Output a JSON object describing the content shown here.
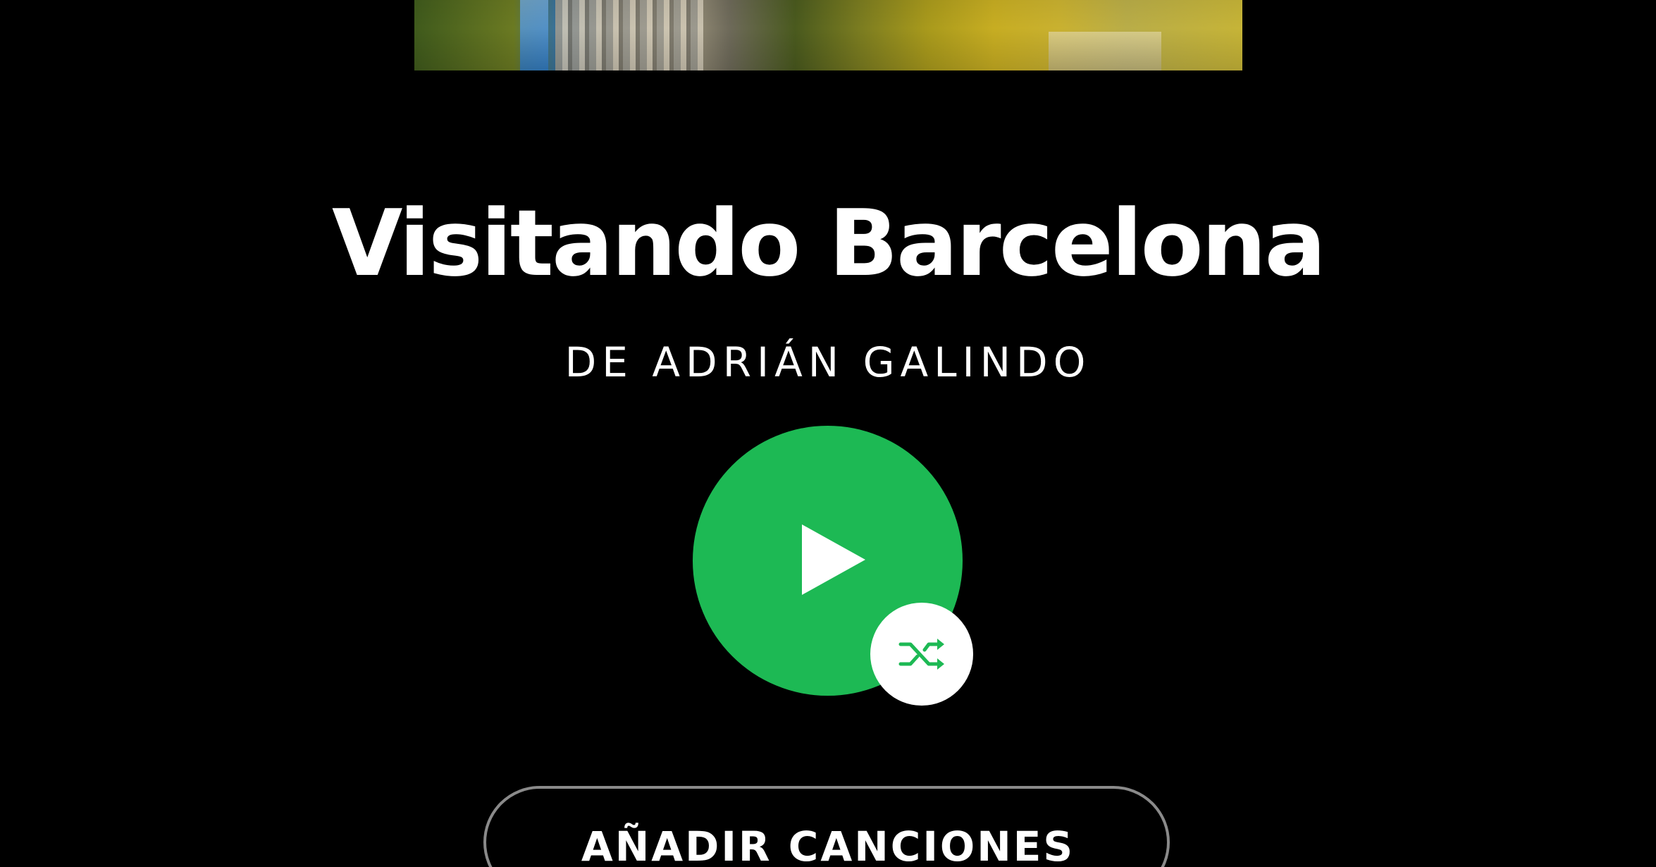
{
  "playlist": {
    "title": "Visitando Barcelona",
    "owner_line": "DE ADRIÁN GALINDO"
  },
  "controls": {
    "play_icon": "play-icon",
    "shuffle_icon": "shuffle-icon",
    "add_songs_label": "AÑADIR CANCIONES"
  },
  "colors": {
    "background": "#000000",
    "accent_green": "#1db954",
    "text": "#ffffff",
    "button_border": "#8a8a8a"
  }
}
